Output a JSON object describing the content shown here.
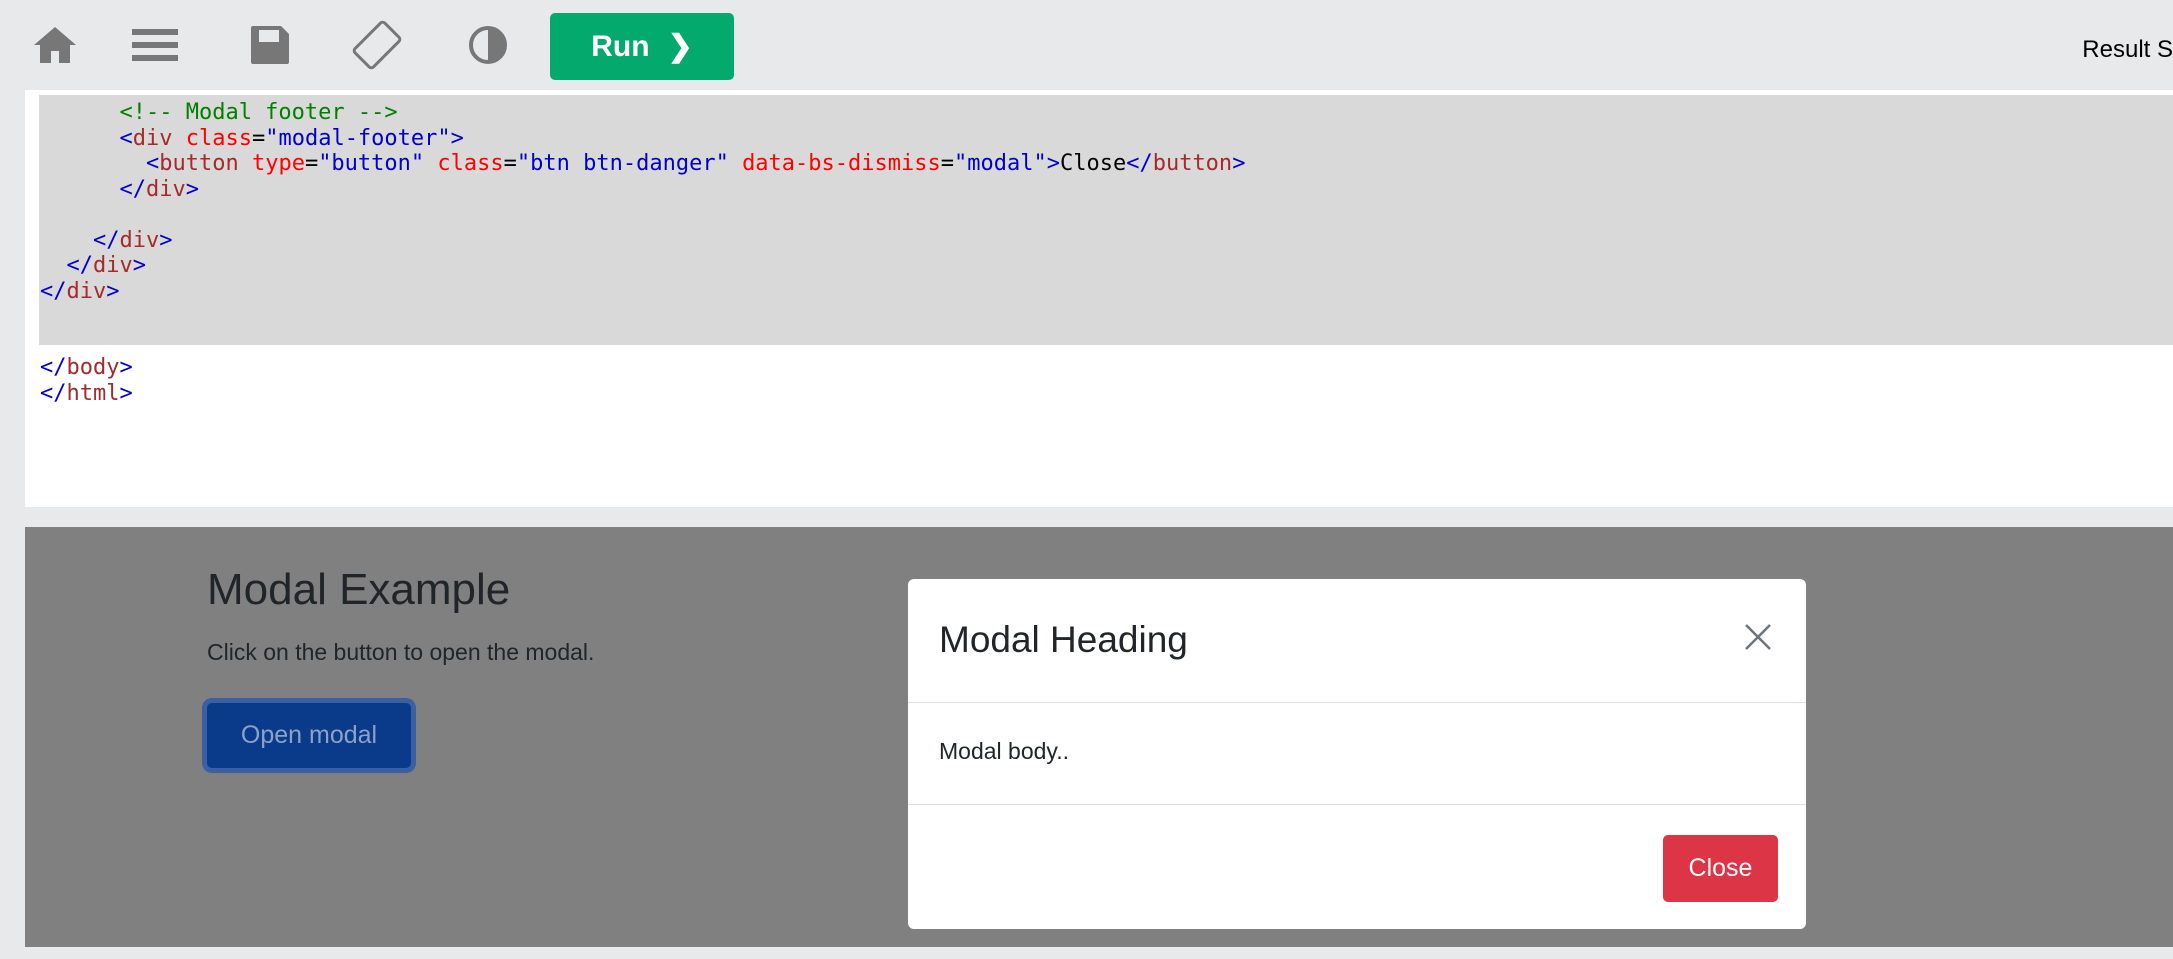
{
  "toolbar": {
    "home_icon": "home-icon",
    "menu_icon": "menu-icon",
    "save_icon": "save-icon",
    "rotate_icon": "rotate-icon",
    "theme_icon": "contrast-icon",
    "run_label": "Run",
    "run_chevron": "❯",
    "result_size_label": "Result S",
    "run_color": "#04aa6d"
  },
  "editor": {
    "lines": [
      "      <!-- Modal footer -->",
      "      <div class=\"modal-footer\">",
      "        <button type=\"button\" class=\"btn btn-danger\" data-bs-dismiss=\"modal\">Close</button>",
      "      </div>",
      "",
      "    </div>",
      "  </div>",
      "</div>",
      "",
      "",
      "</body>",
      "</html>"
    ]
  },
  "result": {
    "page_heading": "Modal Example",
    "page_text": "Click on the button to open the modal.",
    "open_button_label": "Open modal",
    "modal": {
      "title": "Modal Heading",
      "body": "Modal body..",
      "close_button_label": "Close",
      "close_icon": "close-icon",
      "close_button_color": "#dc3545"
    }
  }
}
